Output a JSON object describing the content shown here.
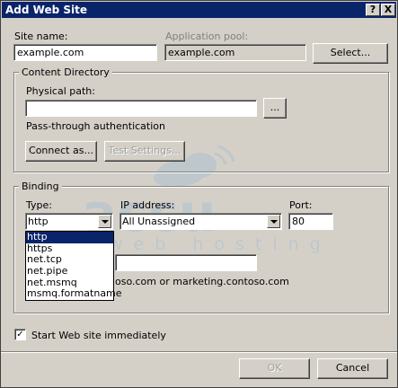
{
  "window": {
    "title": "Add Web Site",
    "help_glyph": "?",
    "close_glyph": "X"
  },
  "site_name": {
    "label": "Site name:",
    "value": "example.com"
  },
  "app_pool": {
    "label": "Application pool:",
    "value": "example.com",
    "select_button": "Select..."
  },
  "content_directory": {
    "legend": "Content Directory",
    "physical_path_label": "Physical path:",
    "physical_path_value": "",
    "browse_button": "...",
    "passthrough_label": "Pass-through authentication",
    "connect_as_button": "Connect as...",
    "test_settings_button": "Test Settings..."
  },
  "binding": {
    "legend": "Binding",
    "type_label": "Type:",
    "type_value": "http",
    "type_options": [
      "http",
      "https",
      "net.tcp",
      "net.pipe",
      "net.msmq",
      "msmq.formatname"
    ],
    "ip_label": "IP address:",
    "ip_value": "All Unassigned",
    "port_label": "Port:",
    "port_value": "80",
    "host_value": "",
    "example_text": "oso.com or marketing.contoso.com"
  },
  "start_immediately": {
    "label": "Start Web site immediately",
    "checked": true,
    "mark": "✓"
  },
  "footer": {
    "ok": "OK",
    "cancel": "Cancel"
  },
  "watermark": {
    "brand": "accu",
    "tagline": "web hosting",
    "color": "#6fa8dc"
  }
}
